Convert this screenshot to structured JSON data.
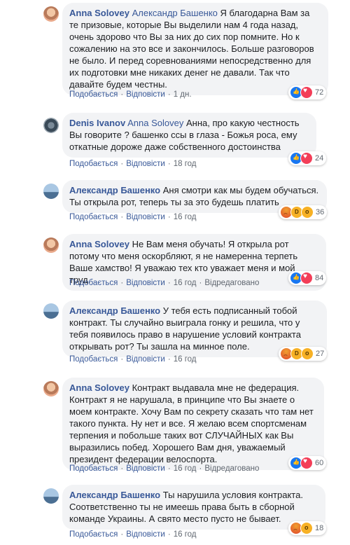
{
  "actions": {
    "like": "Подобається",
    "reply": "Відповісти",
    "edited": "Відредаговано"
  },
  "comments": [
    {
      "author": "Anna Solovey",
      "mention": "Александр Башенко",
      "text": "Я благодарна Вам за те призовые, которые Вы выделили нам 4 года назад, очень здорово что Вы за них до сих пор помните. Но к сожалению на это все и закончилось. Больше разговоров не было. И перед соревнованиями непосредственно для их подготовки мне никаких денег не давали. Так что давайте будем честны.",
      "time": "1 дн.",
      "reactions": [
        "like-icon",
        "love-icon"
      ],
      "count": "72"
    },
    {
      "author": "Denis Ivanov",
      "mention": "Anna Solovey",
      "text": "Анна, про какую честность Вы говорите ? башенко ссы в глаза - Божья роса, ему откатные дороже даже собственного достоинства",
      "time": "18 год",
      "reactions": [
        "like-icon",
        "love-icon"
      ],
      "count": "24"
    },
    {
      "author": "Александр Башенко",
      "mention": "",
      "text": "Аня смотри как мы будем обучаться. Ты открыла рот, теперь ты за это будешь платить",
      "time": "16 год",
      "reactions": [
        "angry-icon",
        "haha-icon",
        "wow-icon"
      ],
      "count": "36"
    },
    {
      "author": "Anna Solovey",
      "mention": "",
      "text": "Не Вам меня обучать! Я открыла рот потому что меня оскорбляют, я не намеренна терпеть Ваше хамство! Я уважаю тех кто уважает меня и мой труд.",
      "time": "16 год",
      "edited": true,
      "reactions": [
        "like-icon",
        "love-icon"
      ],
      "count": "84"
    },
    {
      "author": "Александр Башенко",
      "mention": "",
      "text": "У тебя есть подписанный тобой контракт. Ты случайно выиграла гонку и решила, что у тебя появилось право в нарушение условий контракта открывать рот? Ты зашла на минное поле.",
      "time": "16 год",
      "reactions": [
        "angry-icon",
        "haha-icon",
        "wow-icon"
      ],
      "count": "27"
    },
    {
      "author": "Anna Solovey",
      "mention": "",
      "text": "Контракт выдавала мне не федерация. Контракт я не нарушала, в принципе что Вы знаете о моем контракте. Хочу Вам по секрету сказать что там нет такого пункта. Ну нет и все. Я желаю всем спортсменам терпения и побольше таких вот СЛУЧАЙНЫХ как Вы выразились побед. Хорошего Вам дня, уважаемый президент федерации велоспорта.",
      "time": "16 год",
      "edited": true,
      "reactions": [
        "like-icon",
        "love-icon"
      ],
      "count": "60"
    },
    {
      "author": "Александр Башенко",
      "mention": "",
      "text": "Ты нарушила условия контракта. Соответственно ты не имеешь права быть в сборной команде Украины. А свято место пусто не бывает.",
      "time": "16 год",
      "reactions": [
        "angry-icon",
        "wow-icon"
      ],
      "count": "18"
    }
  ]
}
